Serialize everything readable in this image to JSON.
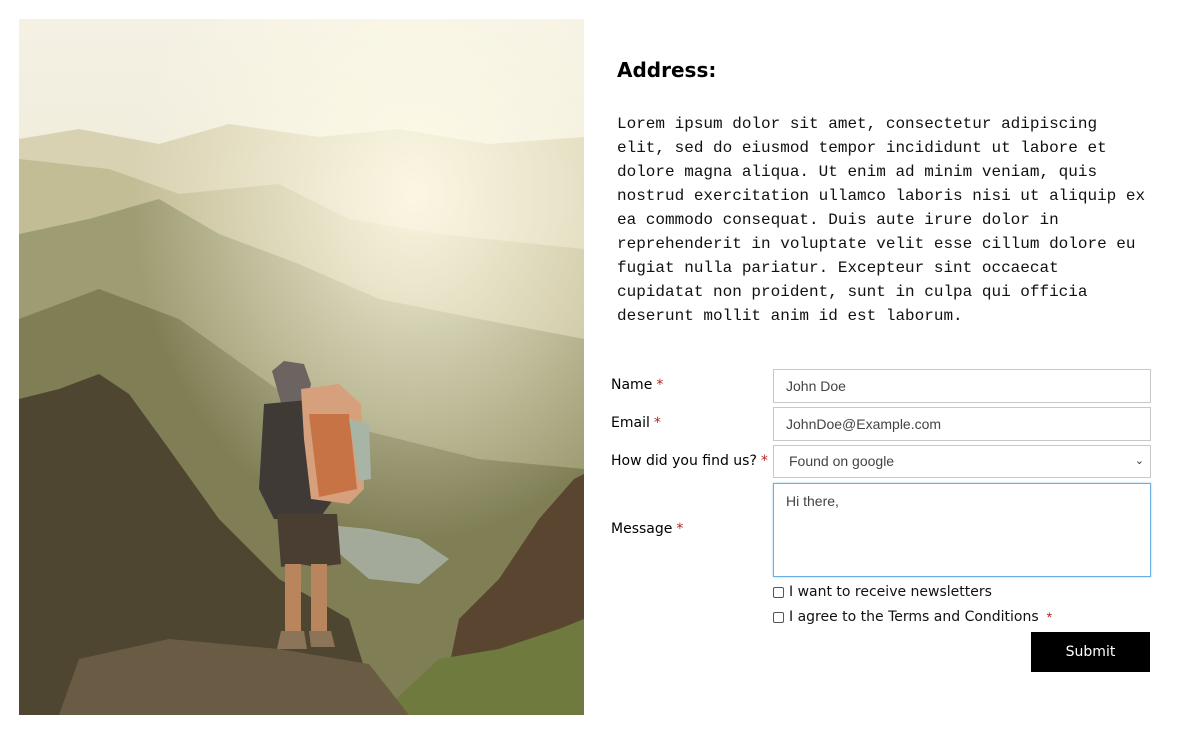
{
  "photo": {
    "subject": "hiker-with-backpack-overlooking-mountains"
  },
  "address": {
    "heading": "Address:",
    "body": "Lorem ipsum dolor sit amet, consectetur adipiscing\nelit, sed do eiusmod tempor incididunt ut labore et\ndolore magna aliqua. Ut enim ad minim veniam, quis\nnostrud exercitation ullamco laboris nisi ut aliquip ex\nea commodo consequat. Duis aute irure dolor in\nreprehenderit in voluptate velit esse cillum dolore eu\nfugiat nulla pariatur. Excepteur sint occaecat\ncupidatat non proident, sunt in culpa qui officia\ndeserunt mollit anim id est laborum."
  },
  "form": {
    "required_marker": "*",
    "name": {
      "label": "Name",
      "value": "John Doe"
    },
    "email": {
      "label": "Email",
      "value": "JohnDoe@Example.com"
    },
    "source": {
      "label": "How did you find us?",
      "selected": "Found on google"
    },
    "message": {
      "label": "Message",
      "value": "Hi there,"
    },
    "newsletter": {
      "label": "I want to receive newsletters",
      "checked": false
    },
    "terms": {
      "label": "I agree to the Terms and Conditions",
      "checked": false
    },
    "submit_label": "Submit"
  },
  "colors": {
    "required": "#b3261e",
    "button_bg": "#000000",
    "focus_border": "#6aaee5"
  }
}
